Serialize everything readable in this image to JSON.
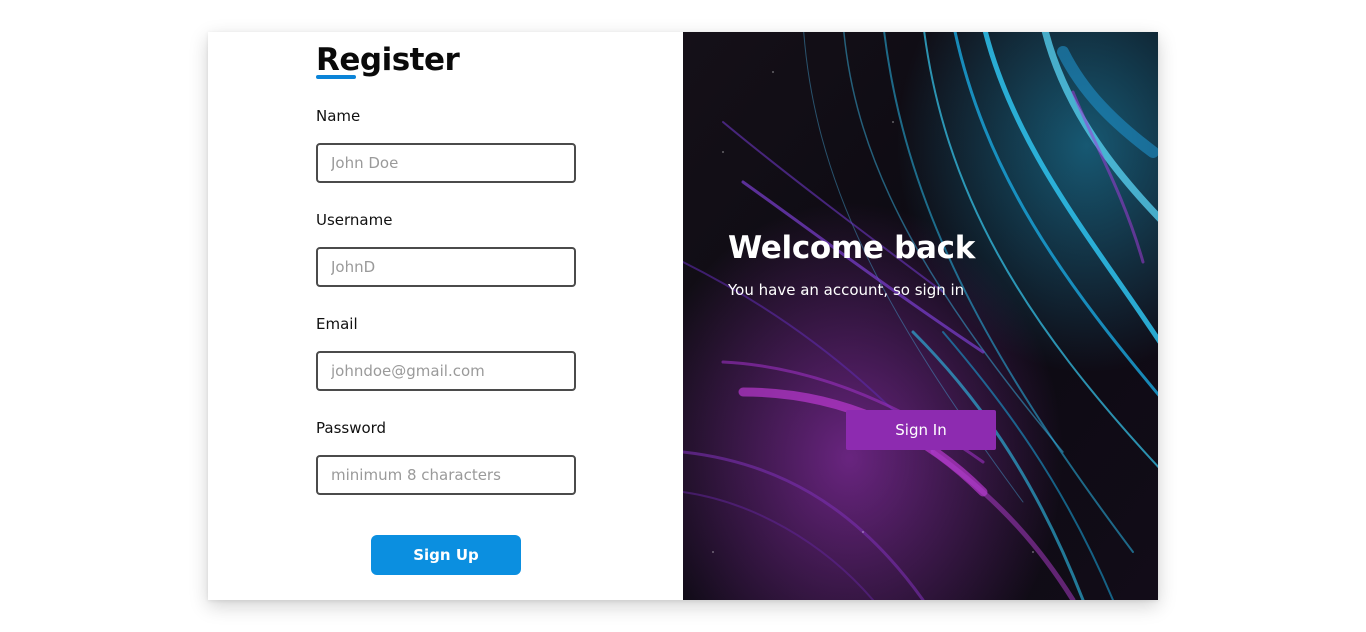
{
  "register": {
    "title": "Register",
    "fields": [
      {
        "label": "Name",
        "placeholder": "John Doe"
      },
      {
        "label": "Username",
        "placeholder": "JohnD"
      },
      {
        "label": "Email",
        "placeholder": "johndoe@gmail.com"
      },
      {
        "label": "Password",
        "placeholder": "minimum 8 characters"
      }
    ],
    "submit_label": "Sign Up"
  },
  "welcome": {
    "heading": "Welcome back",
    "subtext": "You have an account, so sign in",
    "button_label": "Sign In"
  },
  "colors": {
    "primary_blue": "#0b8fe0",
    "accent_purple": "#8d2bb0",
    "input_border": "#4b4b4b"
  }
}
